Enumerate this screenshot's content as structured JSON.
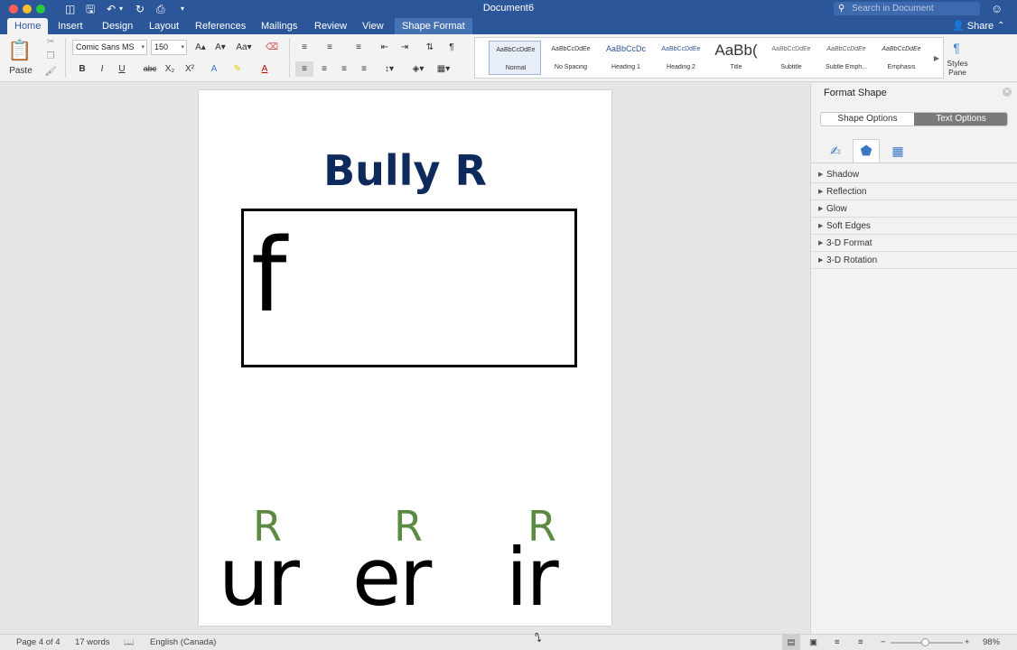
{
  "window": {
    "title": "Document6",
    "search_placeholder": "Search in Document",
    "share_label": "Share"
  },
  "tabs": [
    {
      "label": "Home",
      "active": true
    },
    {
      "label": "Insert"
    },
    {
      "label": "Design"
    },
    {
      "label": "Layout"
    },
    {
      "label": "References"
    },
    {
      "label": "Mailings"
    },
    {
      "label": "Review"
    },
    {
      "label": "View"
    },
    {
      "label": "Shape Format"
    }
  ],
  "ribbon": {
    "paste_label": "Paste",
    "font_name": "Comic Sans MS",
    "font_size": "150",
    "bold": "B",
    "italic": "I",
    "underline": "U",
    "strike": "abc",
    "subscript": "X₂",
    "superscript": "X²",
    "styles_pane_label": "Styles Pane",
    "styles": [
      {
        "sample": "AaBbCcDdEe",
        "name": "Normal"
      },
      {
        "sample": "AaBbCcDdEe",
        "name": "No Spacing"
      },
      {
        "sample": "AaBbCcDc",
        "name": "Heading 1"
      },
      {
        "sample": "AaBbCcDdEe",
        "name": "Heading 2"
      },
      {
        "sample": "AaBb(",
        "name": "Title"
      },
      {
        "sample": "AaBbCcDdEe",
        "name": "Subtitle"
      },
      {
        "sample": "AaBbCcDdEe",
        "name": "Subtle Emph..."
      },
      {
        "sample": "AaBbCcDdEe",
        "name": "Emphasis"
      }
    ]
  },
  "document": {
    "title": "Bully R",
    "textbox_letter": "f",
    "words": [
      "ur",
      "er",
      "ir"
    ],
    "bully_letter": "R",
    "colors": {
      "title": "#0e2a5c",
      "bully_r": "#5c8a43"
    }
  },
  "pane": {
    "title": "Format Shape",
    "tabs": [
      "Shape Options",
      "Text Options"
    ],
    "active_tab": "Text Options",
    "sections": [
      "Shadow",
      "Reflection",
      "Glow",
      "Soft Edges",
      "3-D Format",
      "3-D Rotation"
    ]
  },
  "status": {
    "page": "Page 4 of 4",
    "words": "17 words",
    "language": "English (Canada)",
    "zoom": "98%",
    "zoom_fraction": 0.49
  }
}
